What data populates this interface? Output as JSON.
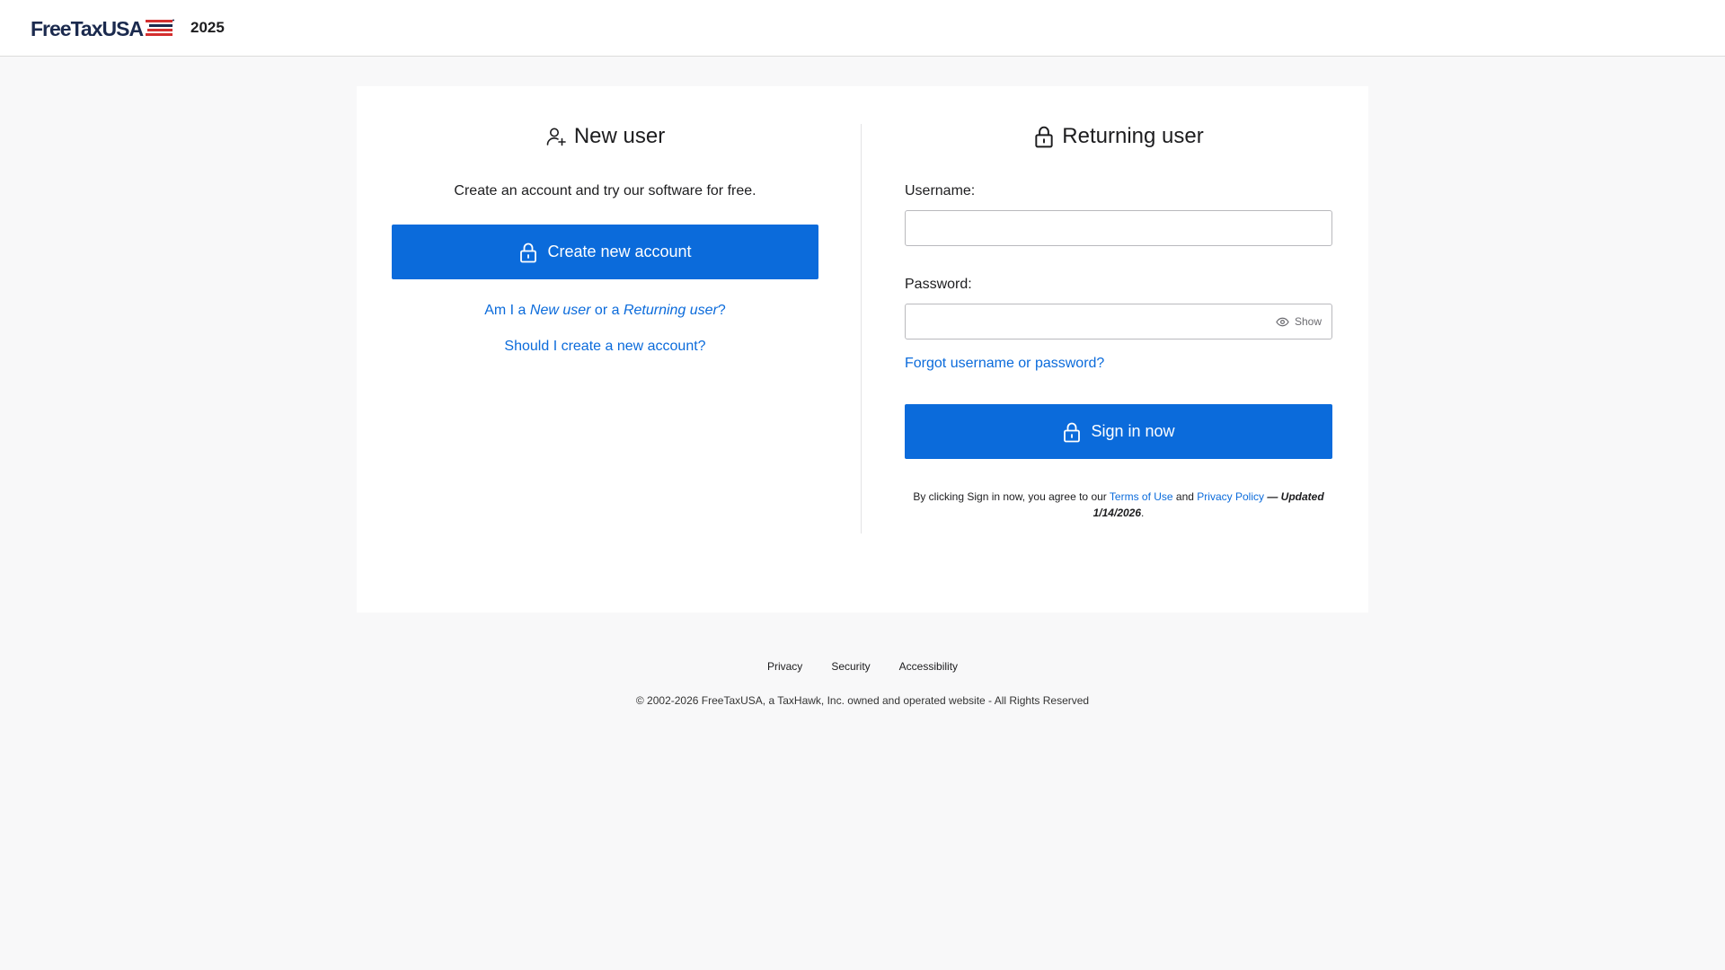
{
  "header": {
    "logo_text": "FreeTaxUSA",
    "year": "2025"
  },
  "new_user": {
    "title": "New user",
    "title_icon": "user-plus-icon",
    "intro": "Create an account and try our software for free.",
    "create_button_label": "Create new account",
    "create_button_icon": "lock-icon",
    "help_link_prefix": "Am I a ",
    "help_link_new": "New user",
    "help_link_mid": " or a ",
    "help_link_returning": "Returning user",
    "help_link_suffix": "?",
    "should_create_link": "Should I create a new account?"
  },
  "returning_user": {
    "title": "Returning user",
    "title_icon": "lock-icon",
    "username_label": "Username:",
    "username_value": "",
    "password_label": "Password:",
    "password_value": "",
    "show_label": "Show",
    "show_icon": "eye-icon",
    "forgot_link": "Forgot username or password?",
    "signin_button_label": "Sign in now",
    "signin_button_icon": "lock-icon",
    "legal_prefix": "By clicking Sign in now, you agree to our ",
    "terms_link": "Terms of Use",
    "legal_and": " and ",
    "privacy_link": "Privacy Policy",
    "legal_updated": " — Updated 1/14/2026",
    "legal_suffix": "."
  },
  "footer": {
    "links": [
      "Privacy",
      "Security",
      "Accessibility"
    ],
    "copyright": "© 2002-2026 FreeTaxUSA, a TaxHawk, Inc. owned and operated website - All Rights Reserved"
  },
  "colors": {
    "primary": "#0b6bdb",
    "logo_navy": "#1b2a4e",
    "logo_red": "#d32f2f"
  }
}
